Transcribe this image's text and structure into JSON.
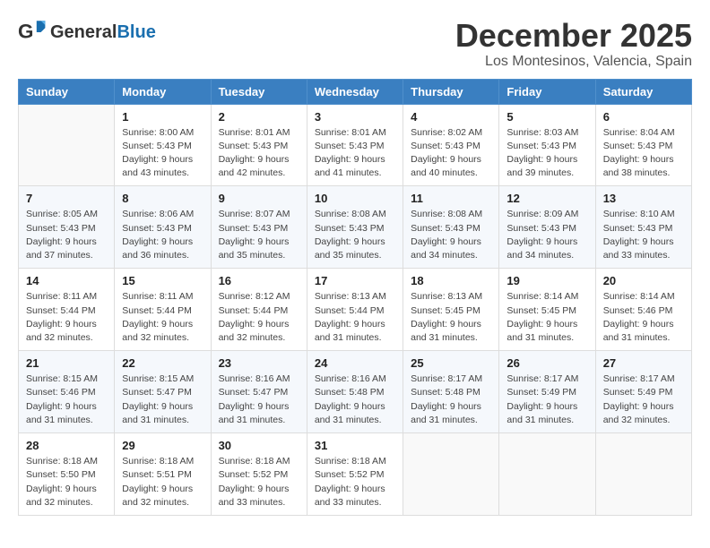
{
  "header": {
    "logo_line1": "General",
    "logo_line2": "Blue",
    "month": "December 2025",
    "location": "Los Montesinos, Valencia, Spain"
  },
  "weekdays": [
    "Sunday",
    "Monday",
    "Tuesday",
    "Wednesday",
    "Thursday",
    "Friday",
    "Saturday"
  ],
  "weeks": [
    [
      {
        "day": "",
        "sunrise": "",
        "sunset": "",
        "daylight": ""
      },
      {
        "day": "1",
        "sunrise": "Sunrise: 8:00 AM",
        "sunset": "Sunset: 5:43 PM",
        "daylight": "Daylight: 9 hours and 43 minutes."
      },
      {
        "day": "2",
        "sunrise": "Sunrise: 8:01 AM",
        "sunset": "Sunset: 5:43 PM",
        "daylight": "Daylight: 9 hours and 42 minutes."
      },
      {
        "day": "3",
        "sunrise": "Sunrise: 8:01 AM",
        "sunset": "Sunset: 5:43 PM",
        "daylight": "Daylight: 9 hours and 41 minutes."
      },
      {
        "day": "4",
        "sunrise": "Sunrise: 8:02 AM",
        "sunset": "Sunset: 5:43 PM",
        "daylight": "Daylight: 9 hours and 40 minutes."
      },
      {
        "day": "5",
        "sunrise": "Sunrise: 8:03 AM",
        "sunset": "Sunset: 5:43 PM",
        "daylight": "Daylight: 9 hours and 39 minutes."
      },
      {
        "day": "6",
        "sunrise": "Sunrise: 8:04 AM",
        "sunset": "Sunset: 5:43 PM",
        "daylight": "Daylight: 9 hours and 38 minutes."
      }
    ],
    [
      {
        "day": "7",
        "sunrise": "Sunrise: 8:05 AM",
        "sunset": "Sunset: 5:43 PM",
        "daylight": "Daylight: 9 hours and 37 minutes."
      },
      {
        "day": "8",
        "sunrise": "Sunrise: 8:06 AM",
        "sunset": "Sunset: 5:43 PM",
        "daylight": "Daylight: 9 hours and 36 minutes."
      },
      {
        "day": "9",
        "sunrise": "Sunrise: 8:07 AM",
        "sunset": "Sunset: 5:43 PM",
        "daylight": "Daylight: 9 hours and 35 minutes."
      },
      {
        "day": "10",
        "sunrise": "Sunrise: 8:08 AM",
        "sunset": "Sunset: 5:43 PM",
        "daylight": "Daylight: 9 hours and 35 minutes."
      },
      {
        "day": "11",
        "sunrise": "Sunrise: 8:08 AM",
        "sunset": "Sunset: 5:43 PM",
        "daylight": "Daylight: 9 hours and 34 minutes."
      },
      {
        "day": "12",
        "sunrise": "Sunrise: 8:09 AM",
        "sunset": "Sunset: 5:43 PM",
        "daylight": "Daylight: 9 hours and 34 minutes."
      },
      {
        "day": "13",
        "sunrise": "Sunrise: 8:10 AM",
        "sunset": "Sunset: 5:43 PM",
        "daylight": "Daylight: 9 hours and 33 minutes."
      }
    ],
    [
      {
        "day": "14",
        "sunrise": "Sunrise: 8:11 AM",
        "sunset": "Sunset: 5:44 PM",
        "daylight": "Daylight: 9 hours and 32 minutes."
      },
      {
        "day": "15",
        "sunrise": "Sunrise: 8:11 AM",
        "sunset": "Sunset: 5:44 PM",
        "daylight": "Daylight: 9 hours and 32 minutes."
      },
      {
        "day": "16",
        "sunrise": "Sunrise: 8:12 AM",
        "sunset": "Sunset: 5:44 PM",
        "daylight": "Daylight: 9 hours and 32 minutes."
      },
      {
        "day": "17",
        "sunrise": "Sunrise: 8:13 AM",
        "sunset": "Sunset: 5:44 PM",
        "daylight": "Daylight: 9 hours and 31 minutes."
      },
      {
        "day": "18",
        "sunrise": "Sunrise: 8:13 AM",
        "sunset": "Sunset: 5:45 PM",
        "daylight": "Daylight: 9 hours and 31 minutes."
      },
      {
        "day": "19",
        "sunrise": "Sunrise: 8:14 AM",
        "sunset": "Sunset: 5:45 PM",
        "daylight": "Daylight: 9 hours and 31 minutes."
      },
      {
        "day": "20",
        "sunrise": "Sunrise: 8:14 AM",
        "sunset": "Sunset: 5:46 PM",
        "daylight": "Daylight: 9 hours and 31 minutes."
      }
    ],
    [
      {
        "day": "21",
        "sunrise": "Sunrise: 8:15 AM",
        "sunset": "Sunset: 5:46 PM",
        "daylight": "Daylight: 9 hours and 31 minutes."
      },
      {
        "day": "22",
        "sunrise": "Sunrise: 8:15 AM",
        "sunset": "Sunset: 5:47 PM",
        "daylight": "Daylight: 9 hours and 31 minutes."
      },
      {
        "day": "23",
        "sunrise": "Sunrise: 8:16 AM",
        "sunset": "Sunset: 5:47 PM",
        "daylight": "Daylight: 9 hours and 31 minutes."
      },
      {
        "day": "24",
        "sunrise": "Sunrise: 8:16 AM",
        "sunset": "Sunset: 5:48 PM",
        "daylight": "Daylight: 9 hours and 31 minutes."
      },
      {
        "day": "25",
        "sunrise": "Sunrise: 8:17 AM",
        "sunset": "Sunset: 5:48 PM",
        "daylight": "Daylight: 9 hours and 31 minutes."
      },
      {
        "day": "26",
        "sunrise": "Sunrise: 8:17 AM",
        "sunset": "Sunset: 5:49 PM",
        "daylight": "Daylight: 9 hours and 31 minutes."
      },
      {
        "day": "27",
        "sunrise": "Sunrise: 8:17 AM",
        "sunset": "Sunset: 5:49 PM",
        "daylight": "Daylight: 9 hours and 32 minutes."
      }
    ],
    [
      {
        "day": "28",
        "sunrise": "Sunrise: 8:18 AM",
        "sunset": "Sunset: 5:50 PM",
        "daylight": "Daylight: 9 hours and 32 minutes."
      },
      {
        "day": "29",
        "sunrise": "Sunrise: 8:18 AM",
        "sunset": "Sunset: 5:51 PM",
        "daylight": "Daylight: 9 hours and 32 minutes."
      },
      {
        "day": "30",
        "sunrise": "Sunrise: 8:18 AM",
        "sunset": "Sunset: 5:52 PM",
        "daylight": "Daylight: 9 hours and 33 minutes."
      },
      {
        "day": "31",
        "sunrise": "Sunrise: 8:18 AM",
        "sunset": "Sunset: 5:52 PM",
        "daylight": "Daylight: 9 hours and 33 minutes."
      },
      {
        "day": "",
        "sunrise": "",
        "sunset": "",
        "daylight": ""
      },
      {
        "day": "",
        "sunrise": "",
        "sunset": "",
        "daylight": ""
      },
      {
        "day": "",
        "sunrise": "",
        "sunset": "",
        "daylight": ""
      }
    ]
  ]
}
